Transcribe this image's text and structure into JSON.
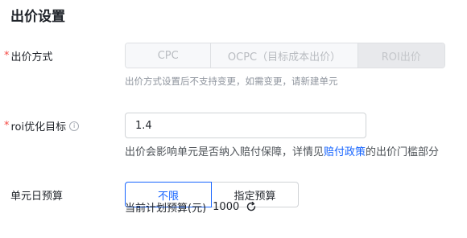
{
  "section": {
    "title": "出价设置"
  },
  "bid_method": {
    "label": "出价方式",
    "required_mark": "*",
    "options": [
      {
        "label": "CPC",
        "selected": false
      },
      {
        "label": "OCPC（目标成本出价）",
        "selected": false
      },
      {
        "label": "ROI出价",
        "selected": true
      }
    ],
    "hint": "出价方式设置后不支持变更，如需变更，请新建单元"
  },
  "roi_target": {
    "label": "roi优化目标",
    "required_mark": "*",
    "info_icon": "info-circle-icon",
    "value": "1.4",
    "desc_prefix": "出价会影响单元是否纳入赔付保障，详情见",
    "desc_link": "赔付政策",
    "desc_suffix": "的出价门槛部分"
  },
  "daily_budget": {
    "label": "单元日预算",
    "options": [
      {
        "label": "不限",
        "selected": true
      },
      {
        "label": "指定预算",
        "selected": false
      }
    ],
    "current_label": "当前计划预算(元)",
    "current_value": "1000",
    "refresh_icon": "refresh-icon"
  },
  "colors": {
    "primary": "#1664ff",
    "required": "#f54a45",
    "hint": "#8f959e"
  }
}
